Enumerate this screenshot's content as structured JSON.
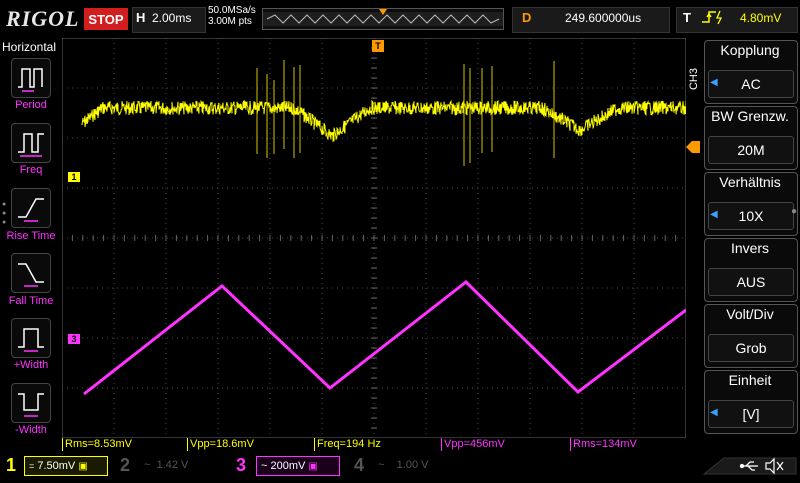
{
  "header": {
    "brand": "RIGOL",
    "run_state": "STOP",
    "timebase_label": "H",
    "timebase_value": "2.00ms",
    "sample_rate": "50.0MSa/s",
    "memory_depth": "3.00M pts",
    "delay_label": "D",
    "delay_value": "249.600000us",
    "trigger_label": "T",
    "trigger_level": "4.80mV"
  },
  "left_panel": {
    "title": "Horizontal",
    "items": [
      {
        "label": "Period"
      },
      {
        "label": "Freq"
      },
      {
        "label": "Rise Time"
      },
      {
        "label": "Fall Time"
      },
      {
        "label": "+Width"
      },
      {
        "label": "-Width"
      }
    ]
  },
  "right_menu": {
    "channel_tag": "CH3",
    "items": [
      {
        "title": "Kopplung",
        "value": "AC"
      },
      {
        "title": "BW Grenzw.",
        "value": "20M"
      },
      {
        "title": "Verhältnis",
        "value": "10X"
      },
      {
        "title": "Invers",
        "value": "AUS"
      },
      {
        "title": "Volt/Div",
        "value": "Grob"
      },
      {
        "title": "Einheit",
        "value": "[V]"
      }
    ]
  },
  "markers": {
    "ch1": "1",
    "ch3": "3",
    "trigger_top": "T"
  },
  "measurements": [
    {
      "text": "Rms=8.53mV",
      "color": "#ffff00"
    },
    {
      "text": "Vpp=18.6mV",
      "color": "#ffff00"
    },
    {
      "text": "Freq=194 Hz",
      "color": "#ffff00"
    },
    {
      "text": "Vpp=456mV",
      "color": "#ff33ff"
    },
    {
      "text": "Rms=134mV",
      "color": "#ff33ff"
    }
  ],
  "channels": [
    {
      "num": "1",
      "coupling": "=",
      "scale": "7.50mV",
      "color": "#ffff00",
      "active": true
    },
    {
      "num": "2",
      "coupling": "~",
      "scale": "1.42 V",
      "color": "#3a8fd6",
      "active": false
    },
    {
      "num": "3",
      "coupling": "~",
      "scale": "200mV",
      "color": "#ff33ff",
      "active": true
    },
    {
      "num": "4",
      "coupling": "~",
      "scale": "1.00 V",
      "color": "#888888",
      "active": false
    }
  ],
  "colors": {
    "ch1": "#ffff00",
    "ch3": "#ff33ff",
    "trigger": "#ff9900",
    "grid": "#555555"
  }
}
